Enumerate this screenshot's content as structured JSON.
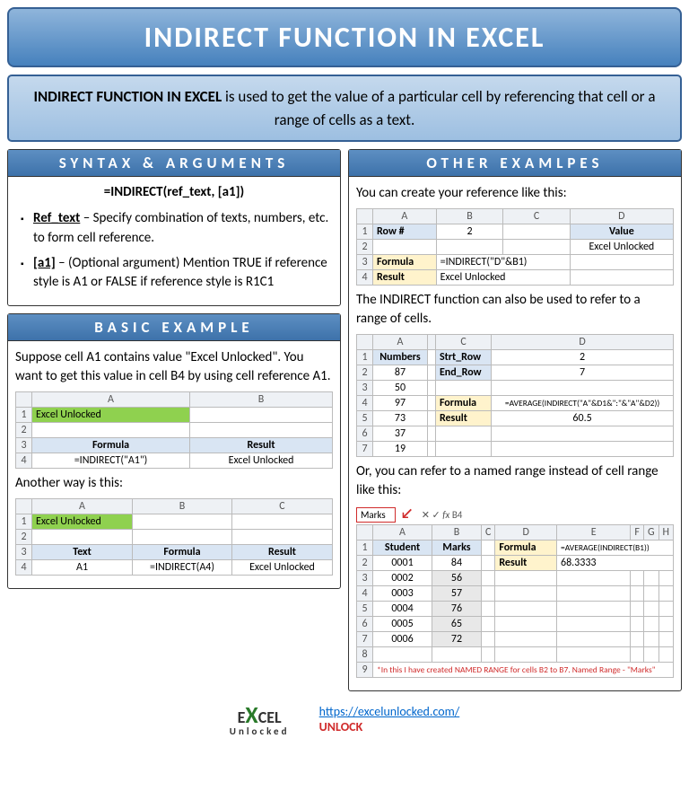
{
  "title": "INDIRECT FUNCTION IN EXCEL",
  "intro": {
    "lead": "INDIRECT FUNCTION IN EXCEL",
    "rest": " is used to get the value of a particular cell by referencing that cell or a range of cells as a text."
  },
  "syntax": {
    "title": "SYNTAX & ARGUMENTS",
    "formula": "=INDIRECT(ref_text, [a1])",
    "arg1_name": "Ref_text",
    "arg1_desc": " – Specify combination of texts, numbers, etc. to form cell reference.",
    "arg2_name": "[a1]",
    "arg2_desc": " – (Optional argument) Mention TRUE if reference style is A1 or FALSE if reference style is R1C1"
  },
  "basic": {
    "title": "BASIC EXAMPLE",
    "p1": "Suppose cell A1 contains value \"Excel Unlocked\". You want to get this value in cell B4 by using cell reference A1.",
    "t1": {
      "a1": "Excel Unlocked",
      "a3": "Formula",
      "b3": "Result",
      "a4": "=INDIRECT(\"A1\")",
      "b4": "Excel Unlocked"
    },
    "p2": "Another way is this:",
    "t2": {
      "a1": "Excel Unlocked",
      "a3": "Text",
      "b3": "Formula",
      "c3": "Result",
      "a4": "A1",
      "b4": "=INDIRECT(A4)",
      "c4": "Excel Unlocked"
    }
  },
  "other": {
    "title": "OTHER EXAMLPES",
    "p1": "You can create your reference like this:",
    "t1": {
      "a1": "Row #",
      "b1": "2",
      "d1": "Value",
      "d2": "Excel Unlocked",
      "a3": "Formula",
      "b3": "=INDIRECT(\"D\"&B1)",
      "a4": "Result",
      "b4": "Excel Unlocked"
    },
    "p2": "The INDIRECT function can also be used to refer to a range of cells.",
    "t2": {
      "a1": "Numbers",
      "c1": "Strt_Row",
      "d1": "2",
      "a2": "87",
      "c2": "End_Row",
      "d2": "7",
      "a3": "50",
      "a4": "97",
      "c4": "Formula",
      "d4": "=AVERAGE(INDIRECT(\"A\"&D1&\":\"&\"A\"&D2))",
      "a5": "73",
      "c5": "Result",
      "d5": "60.5",
      "a6": "37",
      "a7": "19"
    },
    "p3": "Or, you can refer to a named range instead of cell range like this:",
    "t3": {
      "namebox": "Marks",
      "fx": "B4",
      "a1": "Student",
      "b1": "Marks",
      "d1": "Formula",
      "e1": "=AVERAGE(INDIRECT(B1))",
      "d2": "Result",
      "e2": "68.3333",
      "rows": [
        {
          "s": "0001",
          "m": "84"
        },
        {
          "s": "0002",
          "m": "56"
        },
        {
          "s": "0003",
          "m": "57"
        },
        {
          "s": "0004",
          "m": "76"
        },
        {
          "s": "0005",
          "m": "65"
        },
        {
          "s": "0006",
          "m": "72"
        }
      ],
      "note": "*In this I have created NAMED RANGE for cells B2 to B7. Named Range - \"Marks\""
    }
  },
  "footer": {
    "url": "https://excelunlocked.com/",
    "unlock": "UNLOCK",
    "logo1": "E",
    "logo2": "X",
    "logo3": "CEL",
    "logosub": "Unlocked"
  }
}
